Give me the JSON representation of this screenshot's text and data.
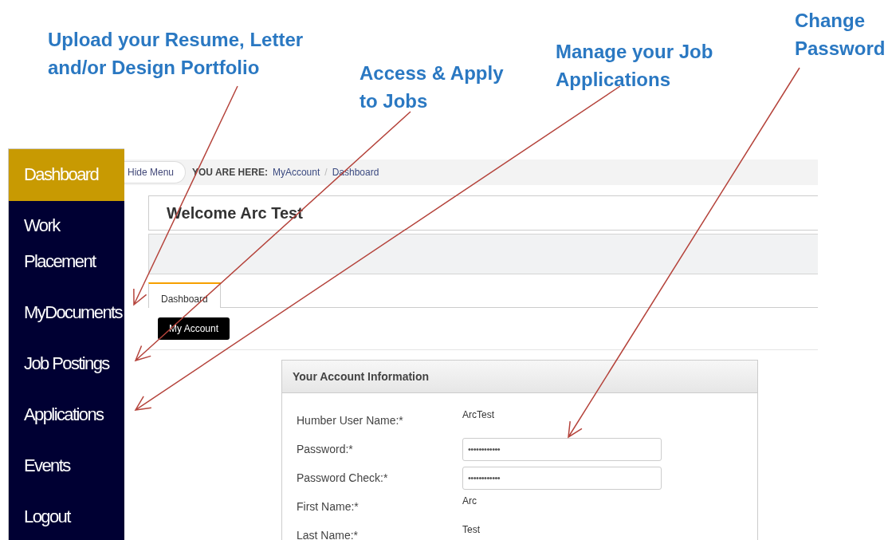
{
  "callouts": [
    {
      "text": "Upload your Resume, Letter and/or Design Portfolio"
    },
    {
      "text": "Access & Apply to Jobs"
    },
    {
      "text": "Manage your Job Applications"
    },
    {
      "text": "Change Password"
    }
  ],
  "sidebar": {
    "items": [
      {
        "label": "Dashboard",
        "selected": true
      },
      {
        "label": "Work Placement",
        "selected": false
      },
      {
        "label": "MyDocuments",
        "selected": false
      },
      {
        "label": "Job Postings",
        "selected": false
      },
      {
        "label": "Applications",
        "selected": false
      },
      {
        "label": "Events",
        "selected": false
      },
      {
        "label": "Logout",
        "selected": false
      }
    ]
  },
  "hide_menu": "Hide Menu",
  "breadcrumb": {
    "prefix": "YOU ARE HERE:",
    "items": [
      "MyAccount",
      "Dashboard"
    ],
    "separator": "/"
  },
  "welcome": "Welcome Arc Test",
  "tabs": [
    {
      "label": "Dashboard",
      "selected": true
    }
  ],
  "my_account_button": "My Account",
  "account_panel": {
    "title": "Your Account Information",
    "fields": [
      {
        "label": "Humber User Name:*",
        "kind": "text",
        "value": "ArcTest"
      },
      {
        "label": "Password:*",
        "kind": "password",
        "value": "••••••••••••"
      },
      {
        "label": "Password Check:*",
        "kind": "password",
        "value": "••••••••••••"
      },
      {
        "label": "First Name:*",
        "kind": "text",
        "value": "Arc"
      },
      {
        "label": "Last Name:*",
        "kind": "text",
        "value": "Test"
      }
    ]
  }
}
